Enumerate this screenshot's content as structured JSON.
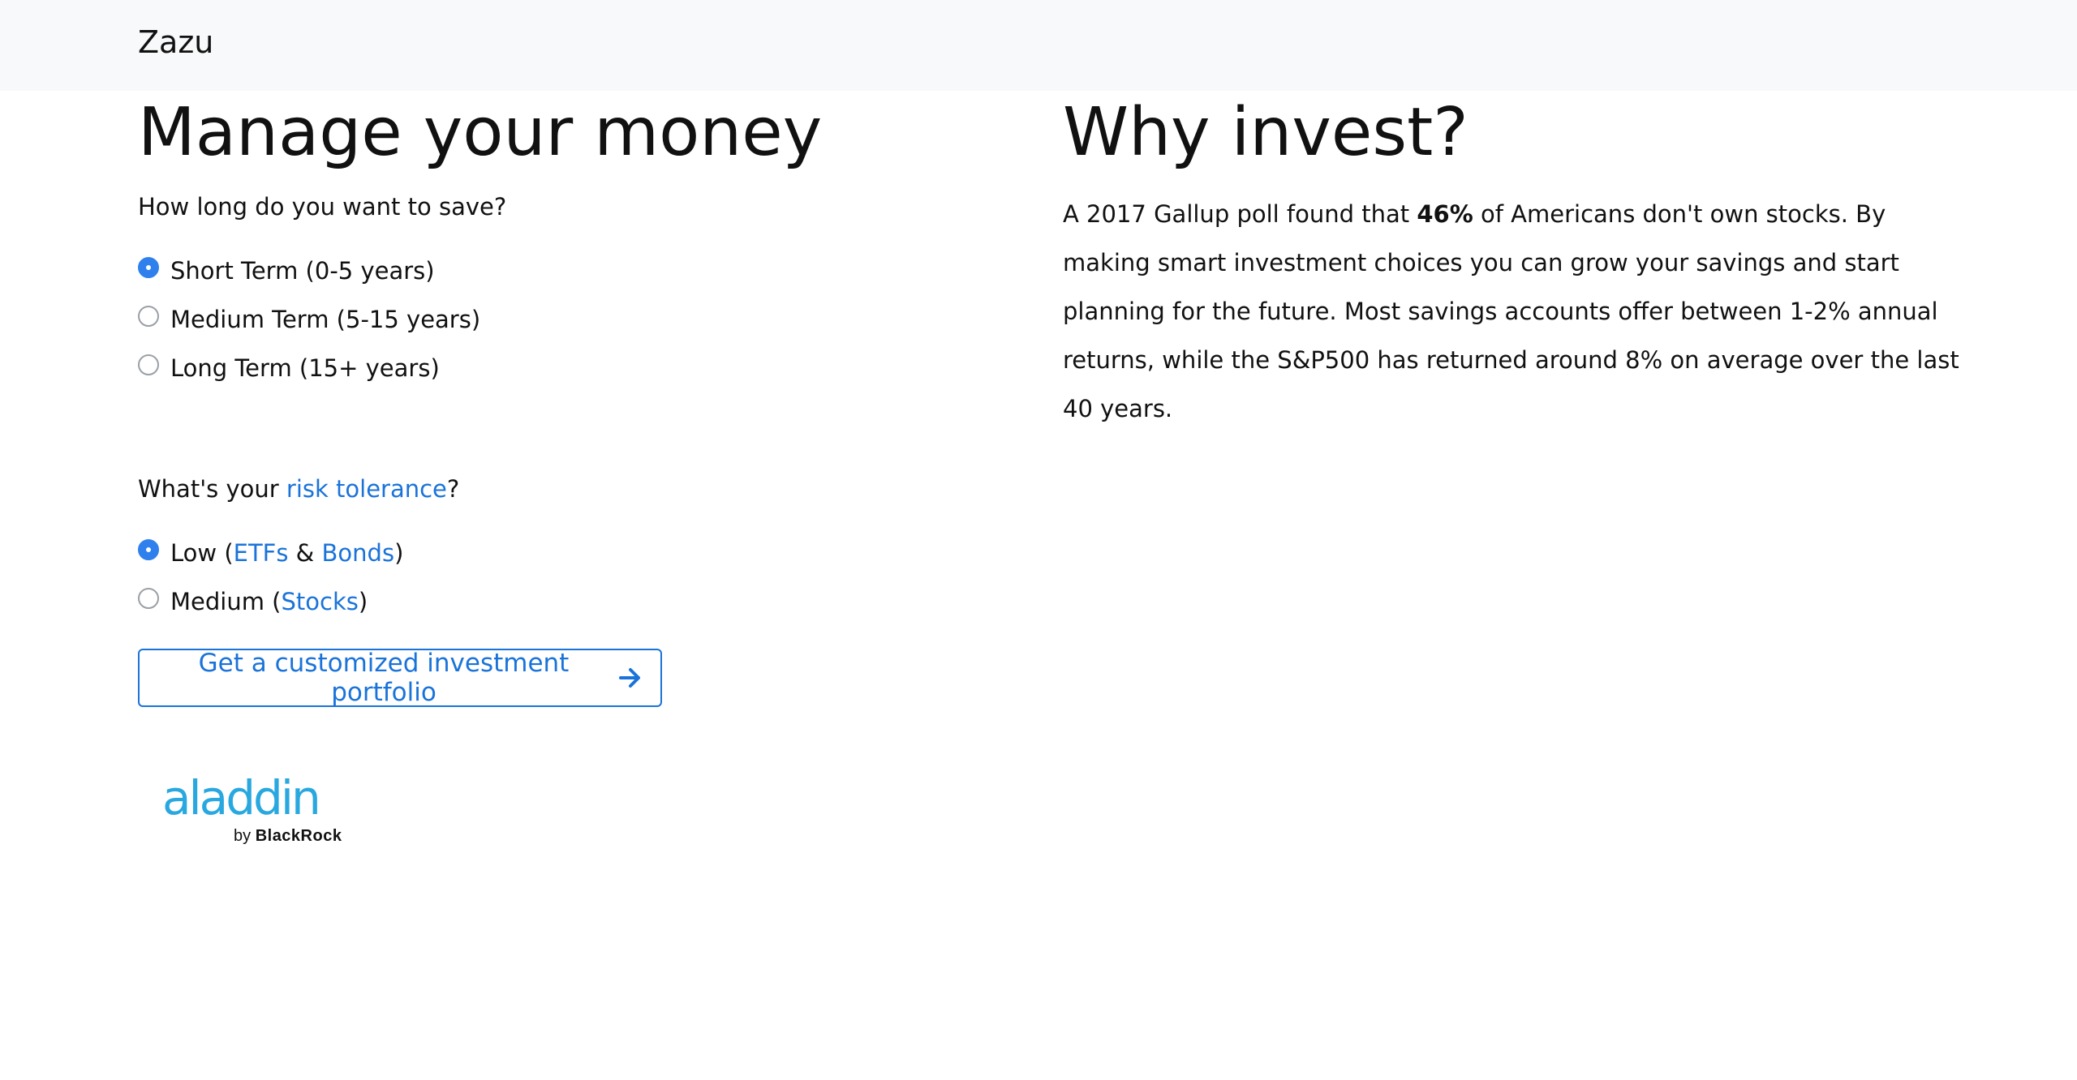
{
  "navbar": {
    "brand": "Zazu"
  },
  "left": {
    "title": "Manage your money",
    "save_question": "How long do you want to save?",
    "save_options": [
      {
        "label": "Short Term (0-5 years)",
        "checked": true
      },
      {
        "label": "Medium Term (5-15 years)",
        "checked": false
      },
      {
        "label": "Long Term (15+ years)",
        "checked": false
      }
    ],
    "risk_question": {
      "prefix": "What's your ",
      "link": "risk tolerance",
      "suffix": "?"
    },
    "risk_options": [
      {
        "text": "Low (",
        "link1": "ETFs",
        "mid": " & ",
        "link2": "Bonds",
        "end": ")",
        "checked": true
      },
      {
        "text": "Medium (",
        "link1": "Stocks",
        "end": ")",
        "checked": false
      }
    ],
    "cta_label": "Get a customized investment portfolio",
    "cta_icon": "arrow-right-icon",
    "logo": {
      "main": "aladdin",
      "by": "by",
      "brand": "BlackRock"
    }
  },
  "right": {
    "title": "Why invest?",
    "paragraph": {
      "before": "A 2017 Gallup poll found that ",
      "bold": "46%",
      "after": " of Americans don't own stocks. By making smart investment choices you can grow your savings and start planning for the future. Most savings accounts offer between 1-2% annual returns, while the S&P500 has returned around 8% on average over the last 40 years."
    }
  },
  "colors": {
    "accent": "#1a73d9",
    "radio_checked": "#2f80ed",
    "navbar_bg": "#f8f9fa",
    "logo_blue": "#29a8e0"
  }
}
